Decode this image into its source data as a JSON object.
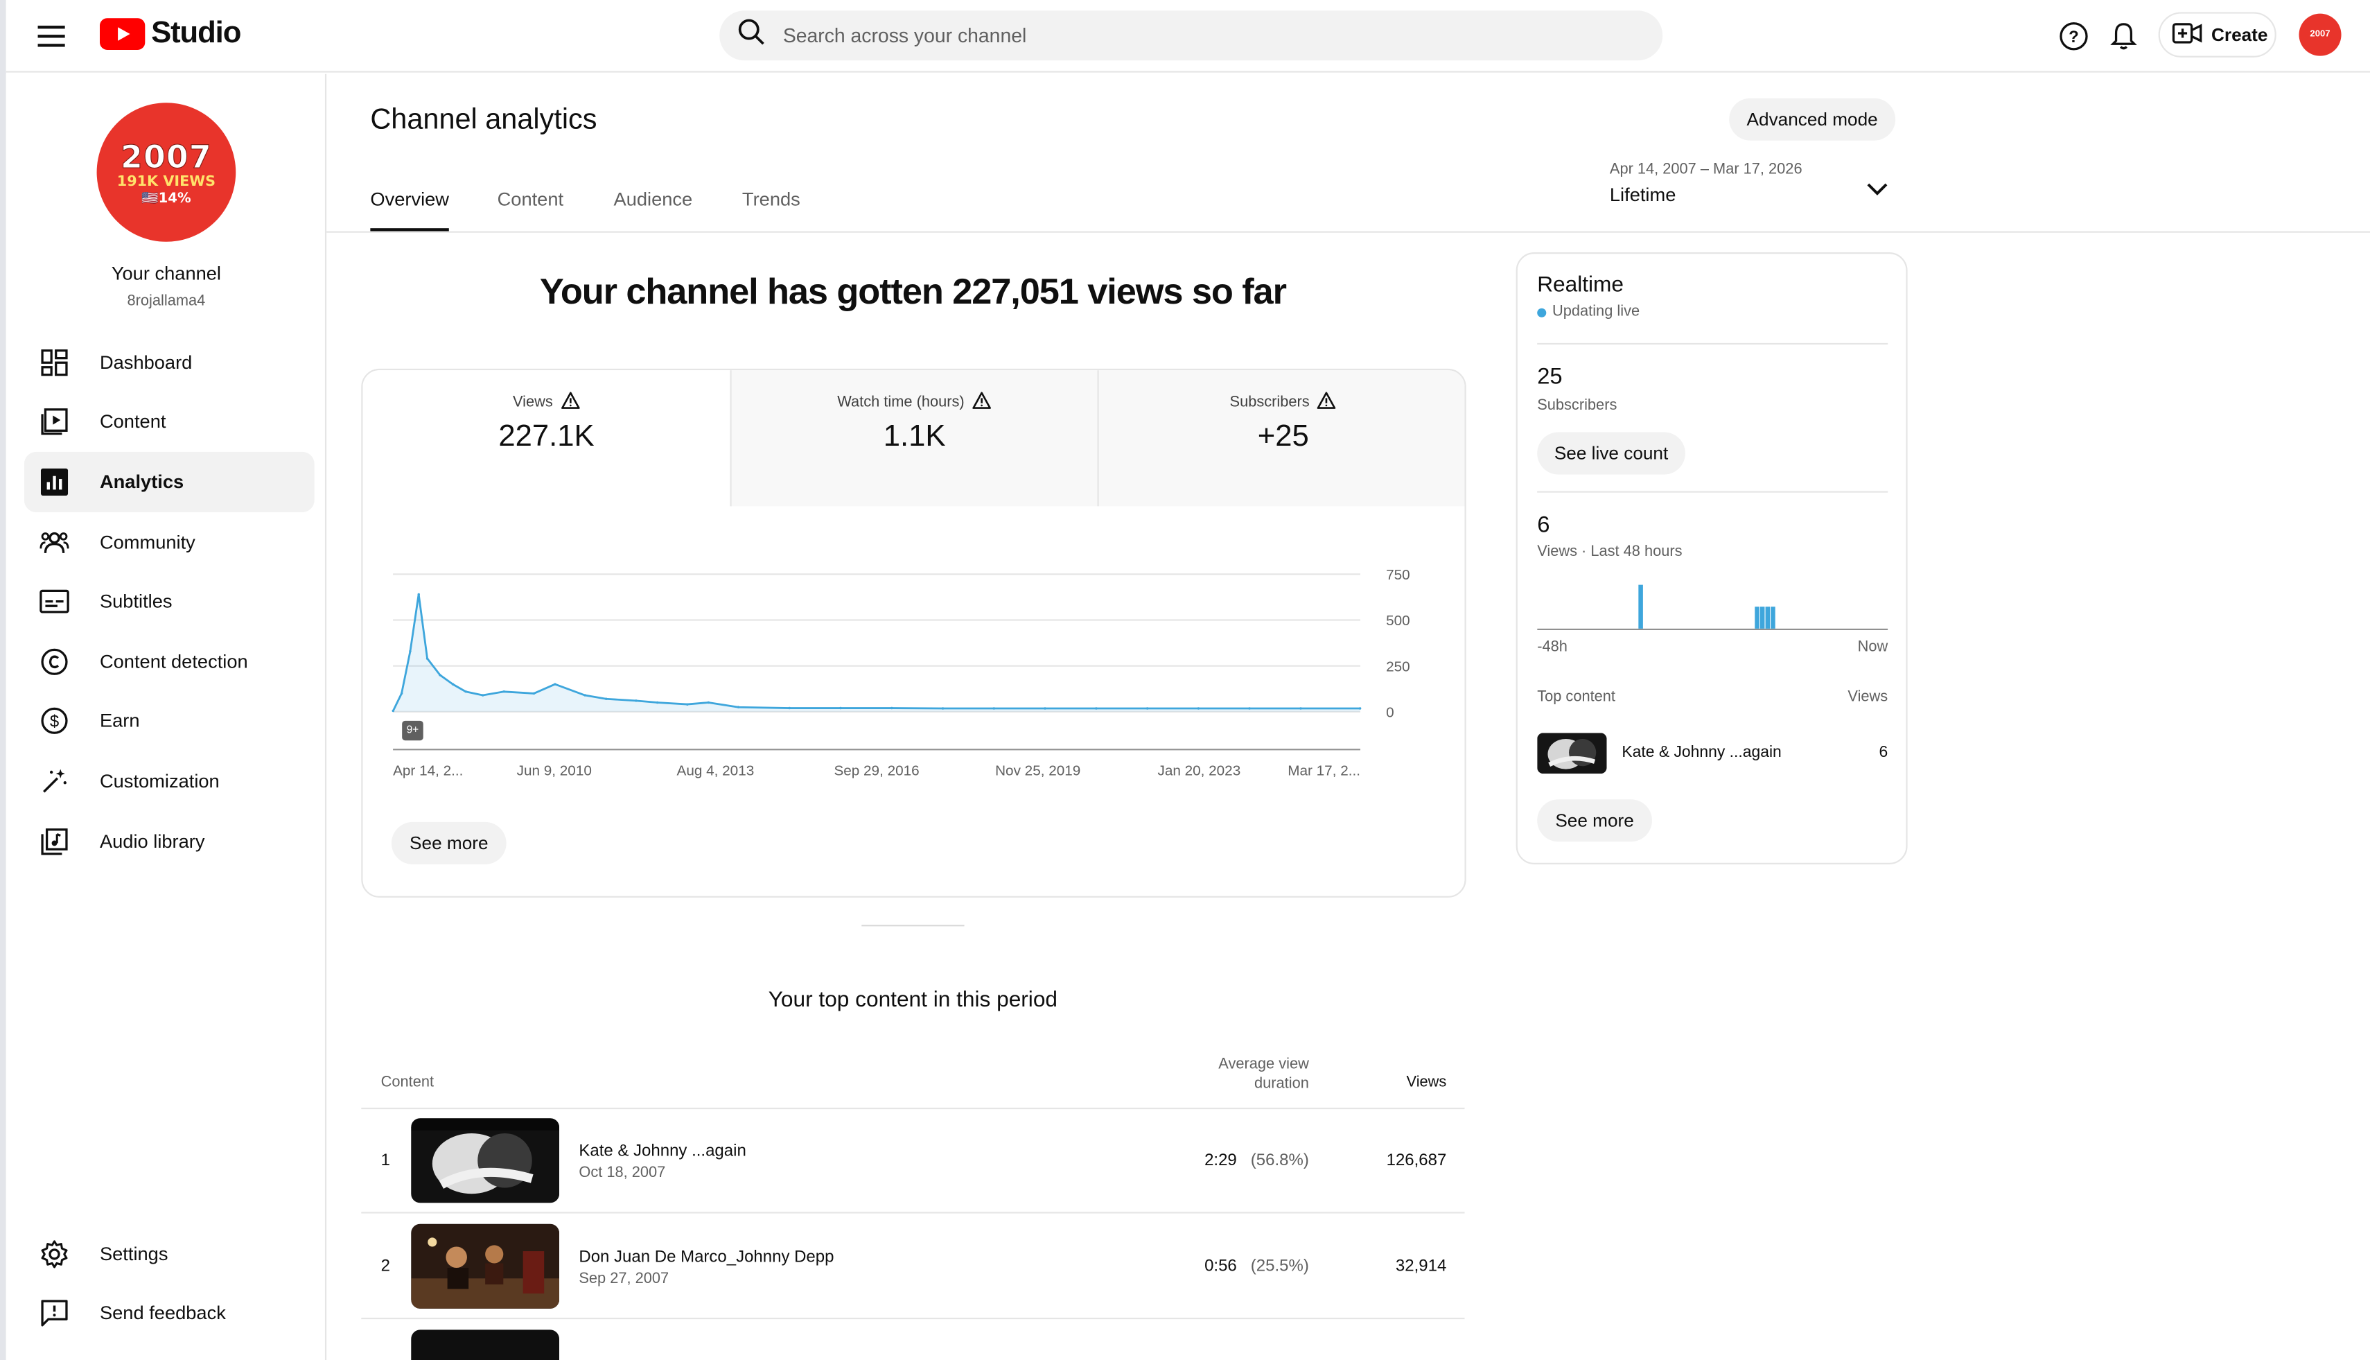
{
  "header": {
    "logo_text": "Studio",
    "search_placeholder": "Search across your channel",
    "create_label": "Create",
    "avatar_text": "2007"
  },
  "sidebar": {
    "avatar": {
      "year": "2007",
      "views": "191K VIEWS",
      "pct": "🇺🇸14%"
    },
    "channel_name": "Your channel",
    "handle": "8rojallama4",
    "items": [
      {
        "label": "Dashboard",
        "icon": "dashboard-icon"
      },
      {
        "label": "Content",
        "icon": "content-icon"
      },
      {
        "label": "Analytics",
        "icon": "analytics-icon",
        "active": true
      },
      {
        "label": "Community",
        "icon": "community-icon"
      },
      {
        "label": "Subtitles",
        "icon": "subtitles-icon"
      },
      {
        "label": "Content detection",
        "icon": "copyright-icon"
      },
      {
        "label": "Earn",
        "icon": "earn-icon"
      },
      {
        "label": "Customization",
        "icon": "magic-wand-icon"
      },
      {
        "label": "Audio library",
        "icon": "audio-library-icon"
      }
    ],
    "bottom_items": [
      {
        "label": "Settings",
        "icon": "gear-icon"
      },
      {
        "label": "Send feedback",
        "icon": "feedback-icon"
      }
    ]
  },
  "main": {
    "title": "Channel analytics",
    "advanced_mode": "Advanced mode",
    "tabs": [
      "Overview",
      "Content",
      "Audience",
      "Trends"
    ],
    "active_tab": "Overview",
    "date_range": "Apr 14, 2007 – Mar 17, 2026",
    "date_label": "Lifetime",
    "headline": "Your channel has gotten 227,051 views so far",
    "metrics": [
      {
        "label": "Views",
        "value": "227.1K"
      },
      {
        "label": "Watch time (hours)",
        "value": "1.1K"
      },
      {
        "label": "Subscribers",
        "value": "+25"
      }
    ],
    "see_more": "See more",
    "badge": "9+",
    "top_content": {
      "title": "Your top content in this period",
      "headers": {
        "content": "Content",
        "avg_line1": "Average view",
        "avg_line2": "duration",
        "views": "Views"
      },
      "rows": [
        {
          "rank": "1",
          "title": "Kate & Johnny ...again",
          "date": "Oct 18, 2007",
          "avg": "2:29",
          "pct": "(56.8%)",
          "views": "126,687"
        },
        {
          "rank": "2",
          "title": "Don Juan De Marco_Johnny Depp",
          "date": "Sep 27, 2007",
          "avg": "0:56",
          "pct": "(25.5%)",
          "views": "32,914"
        }
      ]
    }
  },
  "realtime": {
    "title": "Realtime",
    "status": "Updating live",
    "subscribers_value": "25",
    "subscribers_label": "Subscribers",
    "see_live_count": "See live count",
    "views_value": "6",
    "views_label": "Views · Last 48 hours",
    "axis_start": "-48h",
    "axis_end": "Now",
    "top_content_label": "Top content",
    "views_col": "Views",
    "top_item": {
      "title": "Kate & Johnny ...again",
      "views": "6"
    },
    "see_more": "See more",
    "accent": "#3ea6dc"
  },
  "chart_data": [
    {
      "type": "area",
      "title": "",
      "xlabel": "",
      "ylabel": "",
      "x_ticks": [
        "Apr 14, 2...",
        "Jun 9, 2010",
        "Aug 4, 2013",
        "Sep 29, 2016",
        "Nov 25, 2019",
        "Jan 20, 2023",
        "Mar 17, 2..."
      ],
      "y_ticks": [
        "750",
        "500",
        "250",
        "0"
      ],
      "ylim": [
        0,
        750
      ],
      "grid": true,
      "color": "#3ea6dc",
      "series": [
        {
          "x": [
            "2007-04",
            "2007-06",
            "2007-08",
            "2007-10",
            "2007-12",
            "2008-03",
            "2008-06",
            "2008-09",
            "2009-01",
            "2009-06",
            "2010-01",
            "2010-06",
            "2011-01",
            "2011-06",
            "2012-01",
            "2012-06",
            "2013-01",
            "2013-06",
            "2014-01",
            "2015-01",
            "2016-01",
            "2017-01",
            "2018-01",
            "2019-01",
            "2020-01",
            "2021-01",
            "2022-01",
            "2023-01",
            "2024-01",
            "2025-01",
            "2026-03"
          ],
          "values": [
            5,
            100,
            330,
            640,
            290,
            200,
            150,
            110,
            90,
            110,
            100,
            150,
            90,
            70,
            60,
            50,
            40,
            50,
            25,
            20,
            20,
            20,
            18,
            18,
            18,
            18,
            18,
            18,
            18,
            18,
            18
          ]
        }
      ]
    },
    {
      "type": "bar",
      "title": "",
      "categories": [
        "-48h",
        "-36h",
        "-24h",
        "-20h",
        "-19h",
        "-18h",
        "Now"
      ],
      "values": [
        2,
        0,
        1,
        1,
        1,
        1,
        0
      ],
      "color": "#3ea6dc"
    }
  ]
}
